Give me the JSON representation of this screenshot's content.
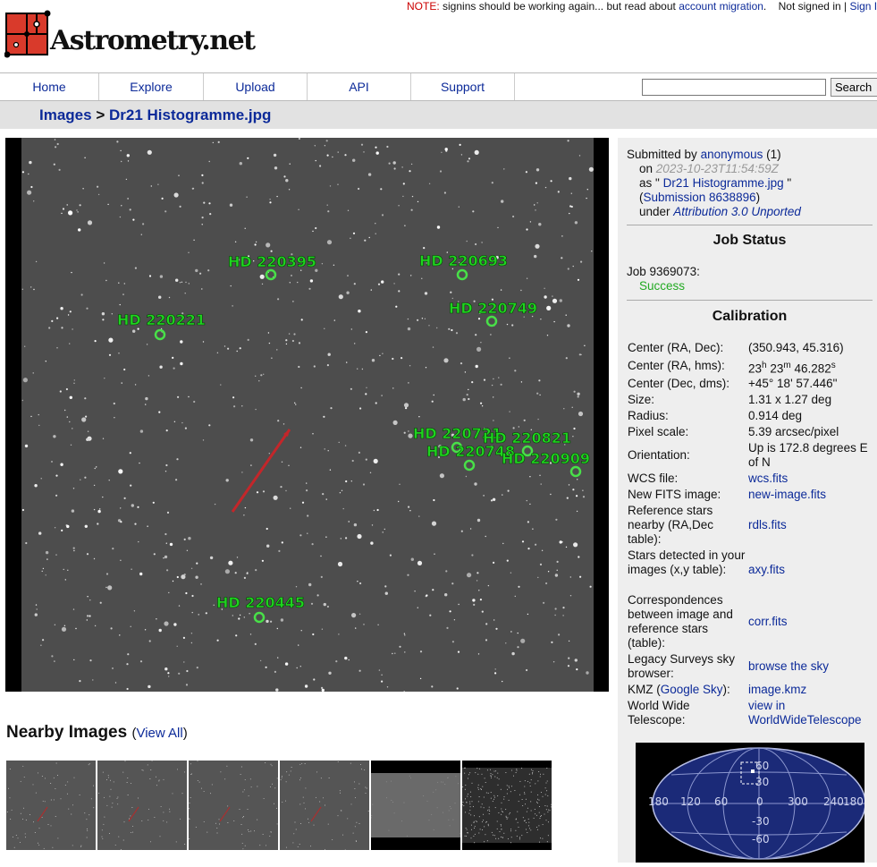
{
  "top_note": {
    "label": "NOTE:",
    "message": "signins should be working again... but read about",
    "link": "account migration",
    "period": ".",
    "auth_status": "Not signed in |",
    "signin": "Sign In"
  },
  "logo": {
    "text": "Astrometry.net"
  },
  "nav": {
    "items": [
      "Home",
      "Explore",
      "Upload",
      "API",
      "Support"
    ],
    "search_value": "",
    "search_button": "Search"
  },
  "breadcrumb": {
    "root": "Images",
    "separator": ">",
    "current": "Dr21 Histogramme.jpg"
  },
  "image_annotations": [
    "HD 220395",
    "HD 220693",
    "HD 220221",
    "HD 220749",
    "HD 220721",
    "HD 220821",
    "HD 220748",
    "HD 220909",
    "HD 220445"
  ],
  "submission": {
    "submitted_by_label": "Submitted by",
    "user": "anonymous",
    "user_count": "(1)",
    "on_label": "on",
    "date": "2023-10-23T11:54:59Z",
    "as_label": "as \"",
    "filename": "Dr21 Histogramme.jpg",
    "as_close": "\"",
    "open_paren": "(",
    "submission_link": "Submission 8638896",
    "close_paren": ")",
    "under_label": "under",
    "license": "Attribution 3.0 Unported"
  },
  "job": {
    "heading": "Job Status",
    "job_label": "Job 9369073:",
    "status": "Success"
  },
  "calibration": {
    "heading": "Calibration",
    "center_radec_label": "Center (RA, Dec):",
    "center_radec": "(350.943, 45.316)",
    "center_hms_label": "Center (RA, hms):",
    "center_hms_h": "23",
    "center_hms_m": "23",
    "center_hms_s": "46.282",
    "center_dms_label": "Center (Dec, dms):",
    "center_dms": "+45° 18' 57.446\"",
    "size_label": "Size:",
    "size": "1.31 x 1.27 deg",
    "radius_label": "Radius:",
    "radius": "0.914 deg",
    "pixel_scale_label": "Pixel scale:",
    "pixel_scale": "5.39 arcsec/pixel",
    "orientation_label": "Orientation:",
    "orientation": "Up is 172.8 degrees E of N",
    "wcs_label": "WCS file:",
    "wcs": "wcs.fits",
    "newfits_label": "New FITS image:",
    "newfits": "new-image.fits",
    "rdls_label": "Reference stars nearby (RA,Dec table):",
    "rdls": "rdls.fits",
    "axy_label": "Stars detected in your images (x,y table):",
    "axy": "axy.fits",
    "corr_label": "Correspondences between image and reference stars (table):",
    "corr": "corr.fits",
    "legacy_label": "Legacy Surveys sky browser:",
    "legacy": "browse the sky",
    "kmz_label_pre": "KMZ (",
    "kmz_label_link": "Google Sky",
    "kmz_label_post": "):",
    "kmz": "image.kmz",
    "wwt_label": "World Wide Telescope:",
    "wwt": "view in WorldWideTelescope"
  },
  "skymap": {
    "ra_ticks": [
      "180",
      "120",
      "60",
      "0",
      "300",
      "240",
      "180"
    ],
    "dec_ticks": [
      "60",
      "30",
      "-30",
      "-60"
    ]
  },
  "nearby": {
    "title": "Nearby Images",
    "view_all_open": "(",
    "view_all": "View All",
    "view_all_close": ")"
  }
}
